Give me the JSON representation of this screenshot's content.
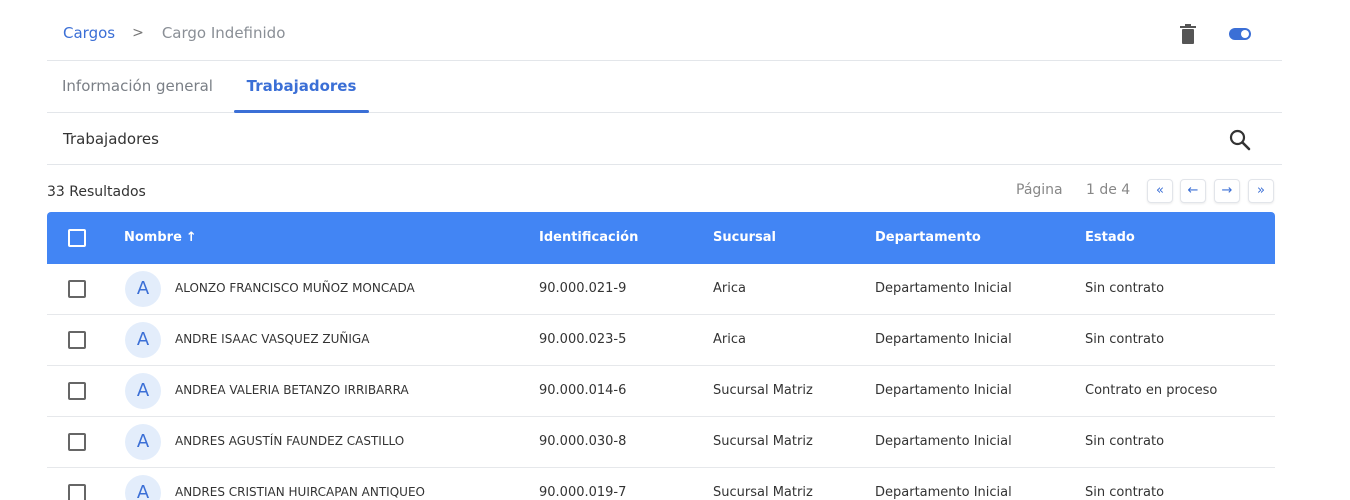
{
  "breadcrumb": {
    "parent": "Cargos",
    "separator": ">",
    "current": "Cargo Indefinido"
  },
  "header_actions": {
    "delete_icon": "trash-icon",
    "toggle_icon": "toggle-icon"
  },
  "tabs": [
    {
      "label": "Información general",
      "active": false
    },
    {
      "label": "Trabajadores",
      "active": true
    }
  ],
  "section": {
    "title": "Trabajadores",
    "search_icon": "search-icon"
  },
  "results": {
    "count_label": "33 Resultados",
    "page_label": "Página",
    "page_value": "1 de 4"
  },
  "pager": {
    "first": "«",
    "prev": "←",
    "next": "→",
    "last": "»"
  },
  "colors": {
    "accent": "#4285f4",
    "link": "#3b6fd6",
    "avatar_bg": "#e3edfb"
  },
  "table": {
    "columns": {
      "name": "Nombre",
      "sort_arrow": "↑",
      "id": "Identificación",
      "branch": "Sucursal",
      "department": "Departamento",
      "state": "Estado"
    },
    "rows": [
      {
        "initial": "A",
        "name": "ALONZO FRANCISCO MUÑOZ MONCADA",
        "id": "90.000.021-9",
        "branch": "Arica",
        "department": "Departamento Inicial",
        "state": "Sin contrato"
      },
      {
        "initial": "A",
        "name": "ANDRE ISAAC VASQUEZ ZUÑIGA",
        "id": "90.000.023-5",
        "branch": "Arica",
        "department": "Departamento Inicial",
        "state": "Sin contrato"
      },
      {
        "initial": "A",
        "name": "ANDREA VALERIA BETANZO IRRIBARRA",
        "id": "90.000.014-6",
        "branch": "Sucursal Matriz",
        "department": "Departamento Inicial",
        "state": "Contrato en proceso"
      },
      {
        "initial": "A",
        "name": "ANDRES AGUSTÍN FAUNDEZ CASTILLO",
        "id": "90.000.030-8",
        "branch": "Sucursal Matriz",
        "department": "Departamento Inicial",
        "state": "Sin contrato"
      },
      {
        "initial": "A",
        "name": "ANDRES CRISTIAN HUIRCAPAN ANTIQUEO",
        "id": "90.000.019-7",
        "branch": "Sucursal Matriz",
        "department": "Departamento Inicial",
        "state": "Sin contrato"
      }
    ]
  }
}
